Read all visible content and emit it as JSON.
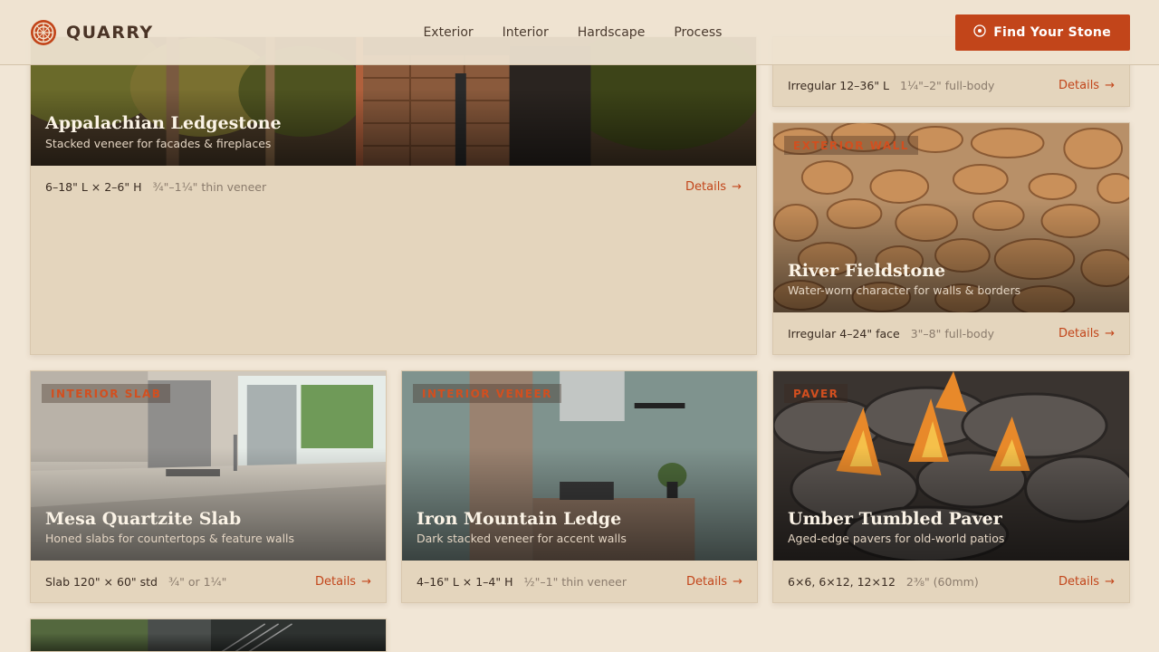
{
  "brand": {
    "name": "QUARRY",
    "icon": "quarry-logo-icon"
  },
  "nav": [
    "Exterior",
    "Interior",
    "Hardscape",
    "Process"
  ],
  "cta": {
    "label": "Find Your Stone",
    "icon": "compass-icon"
  },
  "colors": {
    "accent": "#c2451a",
    "background": "#f1e6d6",
    "card": "#e4d5bd"
  },
  "cards": [
    {
      "tag": "",
      "title": "Appalachian Ledgestone",
      "subtitle": "Stacked veneer for facades & fireplaces",
      "dims": "6–18\" L × 2–6\" H",
      "thickness": "¾\"–1¼\" thin veneer",
      "details": "Details"
    },
    {
      "tag": "",
      "title": "",
      "subtitle": "",
      "dims": "Irregular 12–36\" L",
      "thickness": "1¼\"–2\" full-body",
      "details": "Details"
    },
    {
      "tag": "EXTERIOR WALL",
      "title": "River Fieldstone",
      "subtitle": "Water-worn character for walls & borders",
      "dims": "Irregular 4–24\" face",
      "thickness": "3\"–8\" full-body",
      "details": "Details"
    },
    {
      "tag": "INTERIOR SLAB",
      "title": "Mesa Quartzite Slab",
      "subtitle": "Honed slabs for countertops & feature walls",
      "dims": "Slab 120\" × 60\" std",
      "thickness": "¾\" or 1¼\"",
      "details": "Details"
    },
    {
      "tag": "INTERIOR VENEER",
      "title": "Iron Mountain Ledge",
      "subtitle": "Dark stacked veneer for accent walls",
      "dims": "4–16\" L × 1–4\" H",
      "thickness": "½\"–1\" thin veneer",
      "details": "Details"
    },
    {
      "tag": "PAVER",
      "title": "Umber Tumbled Paver",
      "subtitle": "Aged-edge pavers for old-world patios",
      "dims": "6×6, 6×12, 12×12",
      "thickness": "2⅜\" (60mm)",
      "details": "Details"
    }
  ]
}
